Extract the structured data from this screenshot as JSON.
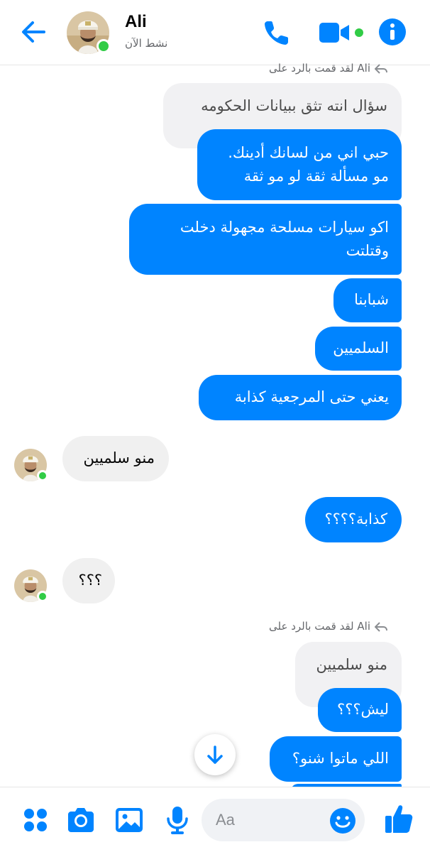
{
  "header": {
    "contact_name": "Ali",
    "status": "نشط الآن",
    "accent_color": "#0084ff",
    "online_color": "#31cc46"
  },
  "messages": {
    "reply_note_1": "Ali لقد قمت بالرد على",
    "quoted_1": "سؤال انته تثق ببيانات الحكومه",
    "out_1_line1": "حبي اني من لسانك أدينك.",
    "out_1_line2": "مو مسألة ثقة لو مو ثقة",
    "out_2_line1": "اكو سيارات مسلحة مجهولة دخلت",
    "out_2_line2": "وقتلتت",
    "out_3": "شبابنا",
    "out_4": "السلميين",
    "out_5": "يعني حتى المرجعية كذابة",
    "in_1": "منو سلميين",
    "out_6": "كذابة؟؟؟؟",
    "in_2": "؟؟؟",
    "reply_note_2": "Ali لقد قمت بالرد على",
    "quoted_2": "منو سلميين",
    "out_7": "ليش؟؟؟",
    "out_8": "اللي ماتوا شنو؟"
  },
  "composer": {
    "placeholder": "Aa"
  },
  "icons": {
    "back": "arrow-left-icon",
    "call": "phone-icon",
    "video": "video-camera-icon",
    "info": "info-icon",
    "menu": "four-dots-icon",
    "camera": "camera-icon",
    "gallery": "image-icon",
    "voice": "microphone-icon",
    "emoji": "smiley-icon",
    "like": "thumbs-up-icon",
    "scroll": "arrow-down-icon"
  }
}
